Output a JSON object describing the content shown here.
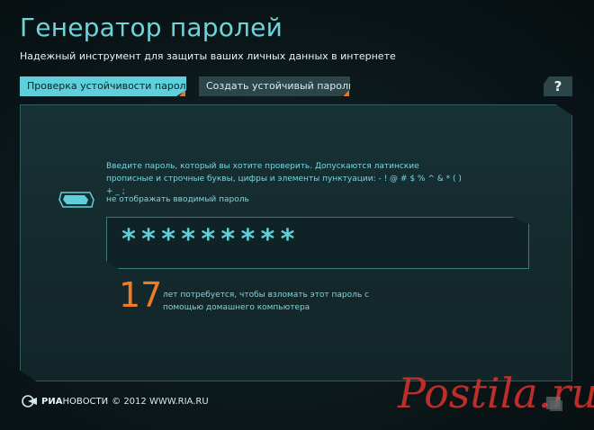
{
  "header": {
    "title": "Генератор паролей",
    "subtitle": "Надежный инструмент для защиты ваших личных данных в интернете"
  },
  "tabs": [
    {
      "label": "Проверка устойчивости пароля",
      "active": true
    },
    {
      "label": "Создать устойчивый пароль",
      "active": false
    }
  ],
  "help": {
    "label": "?"
  },
  "checker": {
    "instructions": "Введите пароль, который вы хотите проверить. Допускаются латинские прописные и строчные буквы, цифры и элементы пунктуации: - ! @ # $ % ^ & * ( ) + _ ;",
    "hide_toggle_label": "не отображать вводимый пароль",
    "password_value": "*********",
    "years": "17",
    "result_text": "лет потребуется, чтобы взломать этот пароль с помощью домашнего компьютера"
  },
  "footer": {
    "brand_bold": "РИА",
    "brand_rest": "НОВОСТИ",
    "copyright": "© 2012 WWW.RIA.RU"
  },
  "watermark": {
    "text": "Postila.ru"
  },
  "colors": {
    "accent": "#5fd0db",
    "orange": "#ee7a2a",
    "background": "#0a1416",
    "panel": "#173235"
  }
}
